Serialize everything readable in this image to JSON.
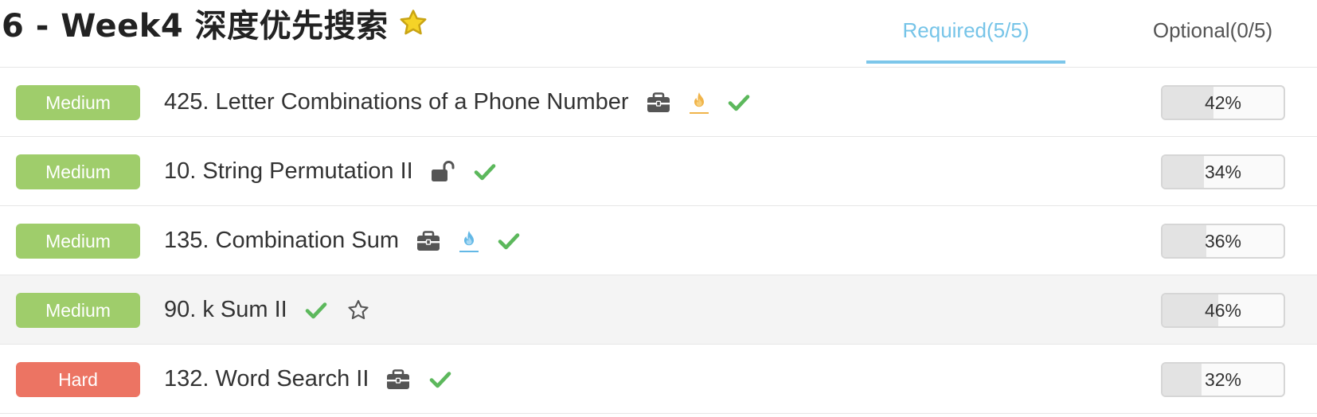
{
  "header": {
    "title": "6 - Week4 深度优先搜索",
    "tabs": [
      {
        "label": "Required(5/5)",
        "active": true
      },
      {
        "label": "Optional(0/5)",
        "active": false
      }
    ]
  },
  "colors": {
    "medium": "#9fcd6b",
    "hard": "#ec7463",
    "check": "#5cb85c",
    "active_tab": "#76c4e8",
    "star": "#f5d327",
    "flame_orange": "#f0b44a",
    "flame_blue": "#63b8e6"
  },
  "problems": [
    {
      "difficulty": "Medium",
      "title": "425. Letter Combinations of a Phone Number",
      "icons": [
        "briefcase-icon",
        "flame-orange-icon",
        "check-icon"
      ],
      "rate": "42%",
      "rate_value": 0.42
    },
    {
      "difficulty": "Medium",
      "title": "10. String Permutation II",
      "icons": [
        "unlock-icon",
        "check-icon"
      ],
      "rate": "34%",
      "rate_value": 0.34
    },
    {
      "difficulty": "Medium",
      "title": "135. Combination Sum",
      "icons": [
        "briefcase-icon",
        "flame-blue-icon",
        "check-icon"
      ],
      "rate": "36%",
      "rate_value": 0.36
    },
    {
      "difficulty": "Medium",
      "title": "90. k Sum II",
      "icons": [
        "check-icon",
        "star-outline-icon"
      ],
      "rate": "46%",
      "rate_value": 0.46
    },
    {
      "difficulty": "Hard",
      "title": "132. Word Search II",
      "icons": [
        "briefcase-icon",
        "check-icon"
      ],
      "rate": "32%",
      "rate_value": 0.32
    }
  ]
}
